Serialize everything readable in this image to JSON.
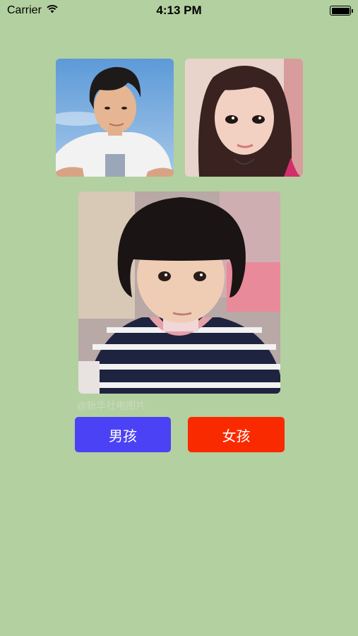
{
  "status_bar": {
    "carrier": "Carrier",
    "time": "4:13 PM",
    "wifi_icon": "wifi-icon",
    "battery_icon": "battery-icon"
  },
  "photos": {
    "father": "boy-photo",
    "mother": "girl-photo",
    "child": "child-photo"
  },
  "watermark": "@新华社电图片",
  "buttons": {
    "boy_label": "男孩",
    "girl_label": "女孩"
  },
  "colors": {
    "background": "#b3d0a0",
    "boy_button": "#4c42f5",
    "girl_button": "#fa2a00"
  }
}
